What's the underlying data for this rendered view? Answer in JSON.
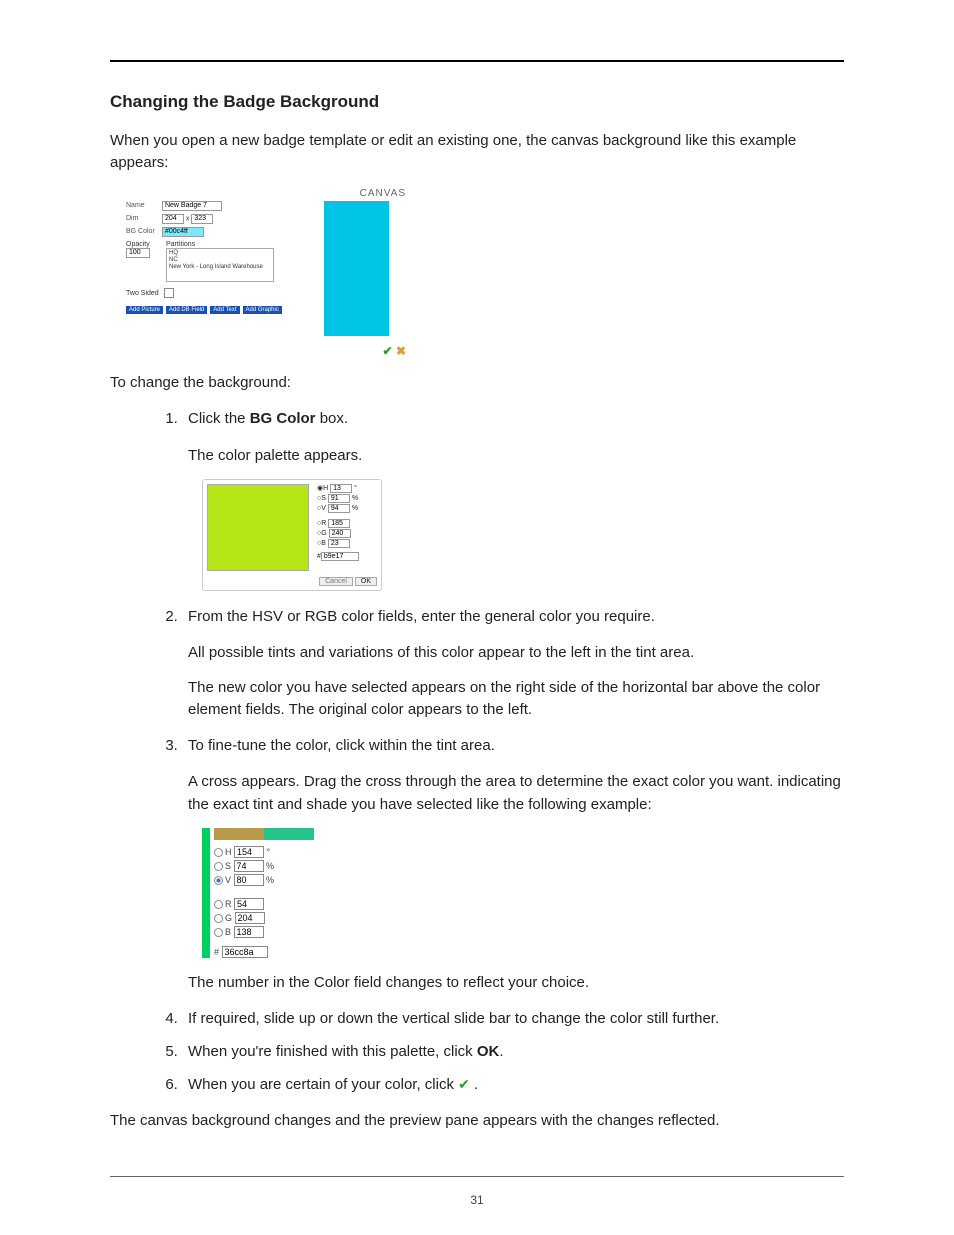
{
  "page_number": "31",
  "heading": "Changing the Badge Background",
  "intro": "When you open a new badge template or edit an existing one, the canvas background like this example appears:",
  "fig1": {
    "canvas_label": "CANVAS",
    "name_label": "Name",
    "name_value": "New Badge 7",
    "dim_label": "Dim",
    "dim_w": "204",
    "dim_x": "x",
    "dim_h": "323",
    "bg_label": "BG Color",
    "bg_value": "#00c4ff",
    "opacity_label": "Opacity",
    "opacity_value": "100",
    "partitions_label": "Partitions",
    "partitions": [
      "HQ",
      "NC",
      "New York - Long Island Warehouse"
    ],
    "twosided_label": "Two Sided",
    "buttons": [
      "Add Picture",
      "Add DB Field",
      "Add Text",
      "Add Graphic"
    ]
  },
  "para_change": "To change the background:",
  "step1_a": "Click the ",
  "step1_b": "BG Color",
  "step1_c": " box.",
  "step1_sub": "The color palette appears.",
  "fig2": {
    "h_label": "H",
    "h_val": "13",
    "s_label": "S",
    "s_val": "91",
    "s_suffix": "%",
    "v_label": "V",
    "v_val": "94",
    "v_suffix": "%",
    "r_label": "R",
    "r_val": "185",
    "g_label": "G",
    "g_val": "240",
    "b_label": "B",
    "b_val": "23",
    "hex_prefix": "#",
    "hex_val": "b9e17",
    "cancel": "Cancel",
    "ok": "OK"
  },
  "step2": "From the HSV or RGB color fields, enter the general color you require.",
  "step2_sub1": "All possible tints and variations of this color appear to the left in the tint area.",
  "step2_sub2": "The new color you have selected appears on the right side of the horizontal bar above the color element fields. The original color appears to the left.",
  "step3": "To fine-tune the color, click within the tint area.",
  "step3_sub": "A cross appears. Drag the cross through the area to determine the exact color you want. indicating the exact tint and shade you have selected like the following example:",
  "fig3": {
    "h_label": "H",
    "h_val": "154",
    "s_label": "S",
    "s_val": "74",
    "s_suffix": "%",
    "v_label": "V",
    "v_val": "80",
    "v_suffix": "%",
    "r_label": "R",
    "r_val": "54",
    "g_label": "G",
    "g_val": "204",
    "b_label": "B",
    "b_val": "138",
    "hex_prefix": "#",
    "hex_val": "36cc8a"
  },
  "step3_sub2": "The number in the Color field changes to reflect your choice.",
  "step4": "If required, slide up or down the vertical slide bar to change the color still further.",
  "step5_a": "When you're finished with this palette, click ",
  "step5_b": "OK",
  "step5_c": ".",
  "step6_a": "When you are certain of your color, click ",
  "step6_b": " .",
  "closing": "The canvas background changes and the preview pane appears with the changes reflected."
}
